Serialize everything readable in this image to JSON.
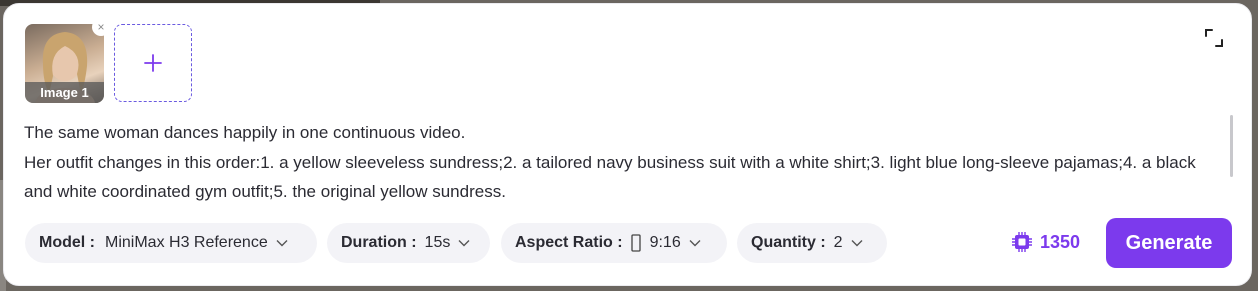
{
  "images": [
    {
      "label": "Image 1"
    }
  ],
  "prompt": "The same woman dances happily in one continuous video.\nHer outfit changes in this order:1. a yellow sleeveless sundress;2. a tailored navy business suit with a white shirt;3. light blue long-sleeve pajamas;4. a black and white coordinated gym outfit;5. the original yellow sundress.",
  "options": {
    "model": {
      "label": "Model :",
      "value": "MiniMax H3 Reference"
    },
    "duration": {
      "label": "Duration :",
      "value": "15s"
    },
    "aspect_ratio": {
      "label": "Aspect Ratio :",
      "value": "9:16"
    },
    "quantity": {
      "label": "Quantity :",
      "value": "2"
    }
  },
  "credits": "1350",
  "generate_label": "Generate",
  "colors": {
    "accent": "#7c3aed",
    "pill_bg": "#f3f3f7"
  },
  "icons": [
    "close-icon",
    "plus-icon",
    "expand-icon",
    "chevron-down-icon",
    "portrait-ratio-icon",
    "credit-chip-icon"
  ]
}
